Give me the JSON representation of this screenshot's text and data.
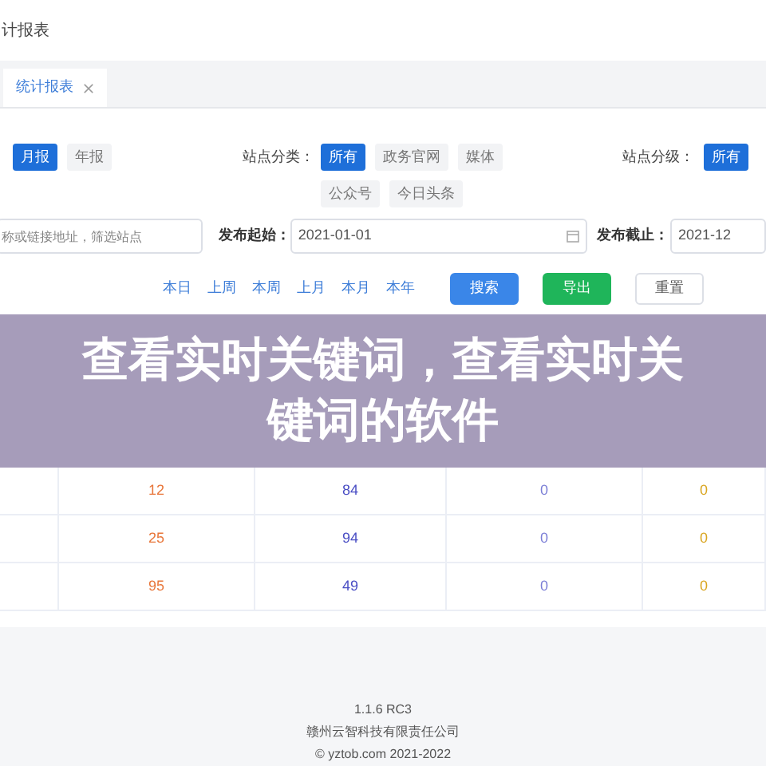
{
  "header": {
    "title": "计报表"
  },
  "tabs": [
    {
      "label": "统计报表",
      "selected": true,
      "closable": true
    }
  ],
  "filters": {
    "period": [
      {
        "label": "月报",
        "selected": true
      },
      {
        "label": "年报",
        "selected": false
      }
    ],
    "site_category": {
      "label": "站点分类：",
      "options": [
        {
          "label": "所有",
          "selected": true
        },
        {
          "label": "政务官网",
          "selected": false
        },
        {
          "label": "媒体",
          "selected": false
        },
        {
          "label": "公众号",
          "selected": false
        },
        {
          "label": "今日头条",
          "selected": false
        }
      ]
    },
    "site_level": {
      "label": "站点分级：",
      "options": [
        {
          "label": "所有",
          "selected": true
        }
      ]
    },
    "search": {
      "placeholder": "称或链接地址，筛选站点"
    },
    "start": {
      "label": "发布起始：",
      "value": "2021-01-01"
    },
    "end": {
      "label": "发布截止：",
      "value": "2021-12"
    },
    "quick_ranges": [
      "本日",
      "上周",
      "本周",
      "上月",
      "本月",
      "本年"
    ],
    "buttons": [
      {
        "label": "搜索",
        "kind": "primary"
      },
      {
        "label": "导出",
        "kind": "success"
      },
      {
        "label": "重置",
        "kind": "plain"
      }
    ]
  },
  "banner": {
    "title": "查看实时关键词，查看实时关键词的软件"
  },
  "table": {
    "rows": [
      {
        "cells": [
          "12",
          "84",
          "0",
          "0"
        ]
      },
      {
        "cells": [
          "25",
          "94",
          "0",
          "0"
        ]
      },
      {
        "cells": [
          "95",
          "49",
          "0",
          "0"
        ]
      }
    ]
  },
  "footer": {
    "version": "1.1.6 RC3",
    "company": "赣州云智科技有限责任公司",
    "copyright": "© yztob.com 2021-2022"
  }
}
